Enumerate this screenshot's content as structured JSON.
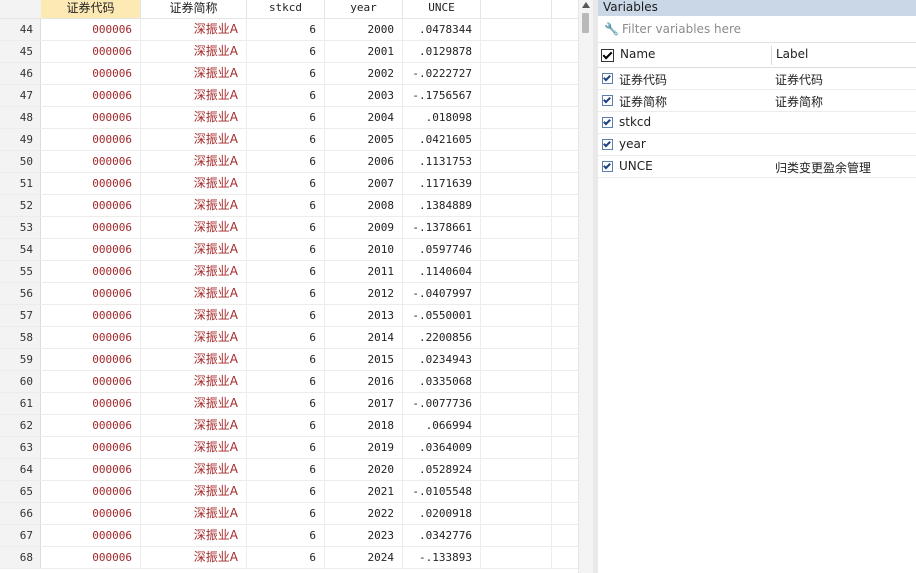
{
  "grid": {
    "columns": [
      "证券代码",
      "证券简称",
      "stkcd",
      "year",
      "UNCE"
    ],
    "rows": [
      {
        "n": "44",
        "code": "000006",
        "name": "深振业A",
        "stkcd": "6",
        "year": "2000",
        "unce": ".0478344"
      },
      {
        "n": "45",
        "code": "000006",
        "name": "深振业A",
        "stkcd": "6",
        "year": "2001",
        "unce": ".0129878"
      },
      {
        "n": "46",
        "code": "000006",
        "name": "深振业A",
        "stkcd": "6",
        "year": "2002",
        "unce": "-.0222727"
      },
      {
        "n": "47",
        "code": "000006",
        "name": "深振业A",
        "stkcd": "6",
        "year": "2003",
        "unce": "-.1756567"
      },
      {
        "n": "48",
        "code": "000006",
        "name": "深振业A",
        "stkcd": "6",
        "year": "2004",
        "unce": ".018098"
      },
      {
        "n": "49",
        "code": "000006",
        "name": "深振业A",
        "stkcd": "6",
        "year": "2005",
        "unce": ".0421605"
      },
      {
        "n": "50",
        "code": "000006",
        "name": "深振业A",
        "stkcd": "6",
        "year": "2006",
        "unce": ".1131753"
      },
      {
        "n": "51",
        "code": "000006",
        "name": "深振业A",
        "stkcd": "6",
        "year": "2007",
        "unce": ".1171639"
      },
      {
        "n": "52",
        "code": "000006",
        "name": "深振业A",
        "stkcd": "6",
        "year": "2008",
        "unce": ".1384889"
      },
      {
        "n": "53",
        "code": "000006",
        "name": "深振业A",
        "stkcd": "6",
        "year": "2009",
        "unce": "-.1378661"
      },
      {
        "n": "54",
        "code": "000006",
        "name": "深振业A",
        "stkcd": "6",
        "year": "2010",
        "unce": ".0597746"
      },
      {
        "n": "55",
        "code": "000006",
        "name": "深振业A",
        "stkcd": "6",
        "year": "2011",
        "unce": ".1140604"
      },
      {
        "n": "56",
        "code": "000006",
        "name": "深振业A",
        "stkcd": "6",
        "year": "2012",
        "unce": "-.0407997"
      },
      {
        "n": "57",
        "code": "000006",
        "name": "深振业A",
        "stkcd": "6",
        "year": "2013",
        "unce": "-.0550001"
      },
      {
        "n": "58",
        "code": "000006",
        "name": "深振业A",
        "stkcd": "6",
        "year": "2014",
        "unce": ".2200856"
      },
      {
        "n": "59",
        "code": "000006",
        "name": "深振业A",
        "stkcd": "6",
        "year": "2015",
        "unce": ".0234943"
      },
      {
        "n": "60",
        "code": "000006",
        "name": "深振业A",
        "stkcd": "6",
        "year": "2016",
        "unce": ".0335068"
      },
      {
        "n": "61",
        "code": "000006",
        "name": "深振业A",
        "stkcd": "6",
        "year": "2017",
        "unce": "-.0077736"
      },
      {
        "n": "62",
        "code": "000006",
        "name": "深振业A",
        "stkcd": "6",
        "year": "2018",
        "unce": ".066994"
      },
      {
        "n": "63",
        "code": "000006",
        "name": "深振业A",
        "stkcd": "6",
        "year": "2019",
        "unce": ".0364009"
      },
      {
        "n": "64",
        "code": "000006",
        "name": "深振业A",
        "stkcd": "6",
        "year": "2020",
        "unce": ".0528924"
      },
      {
        "n": "65",
        "code": "000006",
        "name": "深振业A",
        "stkcd": "6",
        "year": "2021",
        "unce": "-.0105548"
      },
      {
        "n": "66",
        "code": "000006",
        "name": "深振业A",
        "stkcd": "6",
        "year": "2022",
        "unce": ".0200918"
      },
      {
        "n": "67",
        "code": "000006",
        "name": "深振业A",
        "stkcd": "6",
        "year": "2023",
        "unce": ".0342776"
      },
      {
        "n": "68",
        "code": "000006",
        "name": "深振业A",
        "stkcd": "6",
        "year": "2024",
        "unce": "-.133893"
      }
    ]
  },
  "variables": {
    "title": "Variables",
    "filter_placeholder": "Filter variables here",
    "col_name": "Name",
    "col_label": "Label",
    "items": [
      {
        "name": "证券代码",
        "label": "证券代码"
      },
      {
        "name": "证券简称",
        "label": "证券简称"
      },
      {
        "name": "stkcd",
        "label": ""
      },
      {
        "name": "year",
        "label": ""
      },
      {
        "name": "UNCE",
        "label": "归类变更盈余管理"
      }
    ]
  },
  "colors": {
    "string_text": "#a4282a",
    "selected_header": "#fde9b4",
    "panel_title_bg": "#c9d7e6",
    "wrench_icon": "#3a6fb0"
  },
  "icons": [
    "wrench-icon",
    "checkbox-icon",
    "scroll-up-arrow-icon"
  ]
}
